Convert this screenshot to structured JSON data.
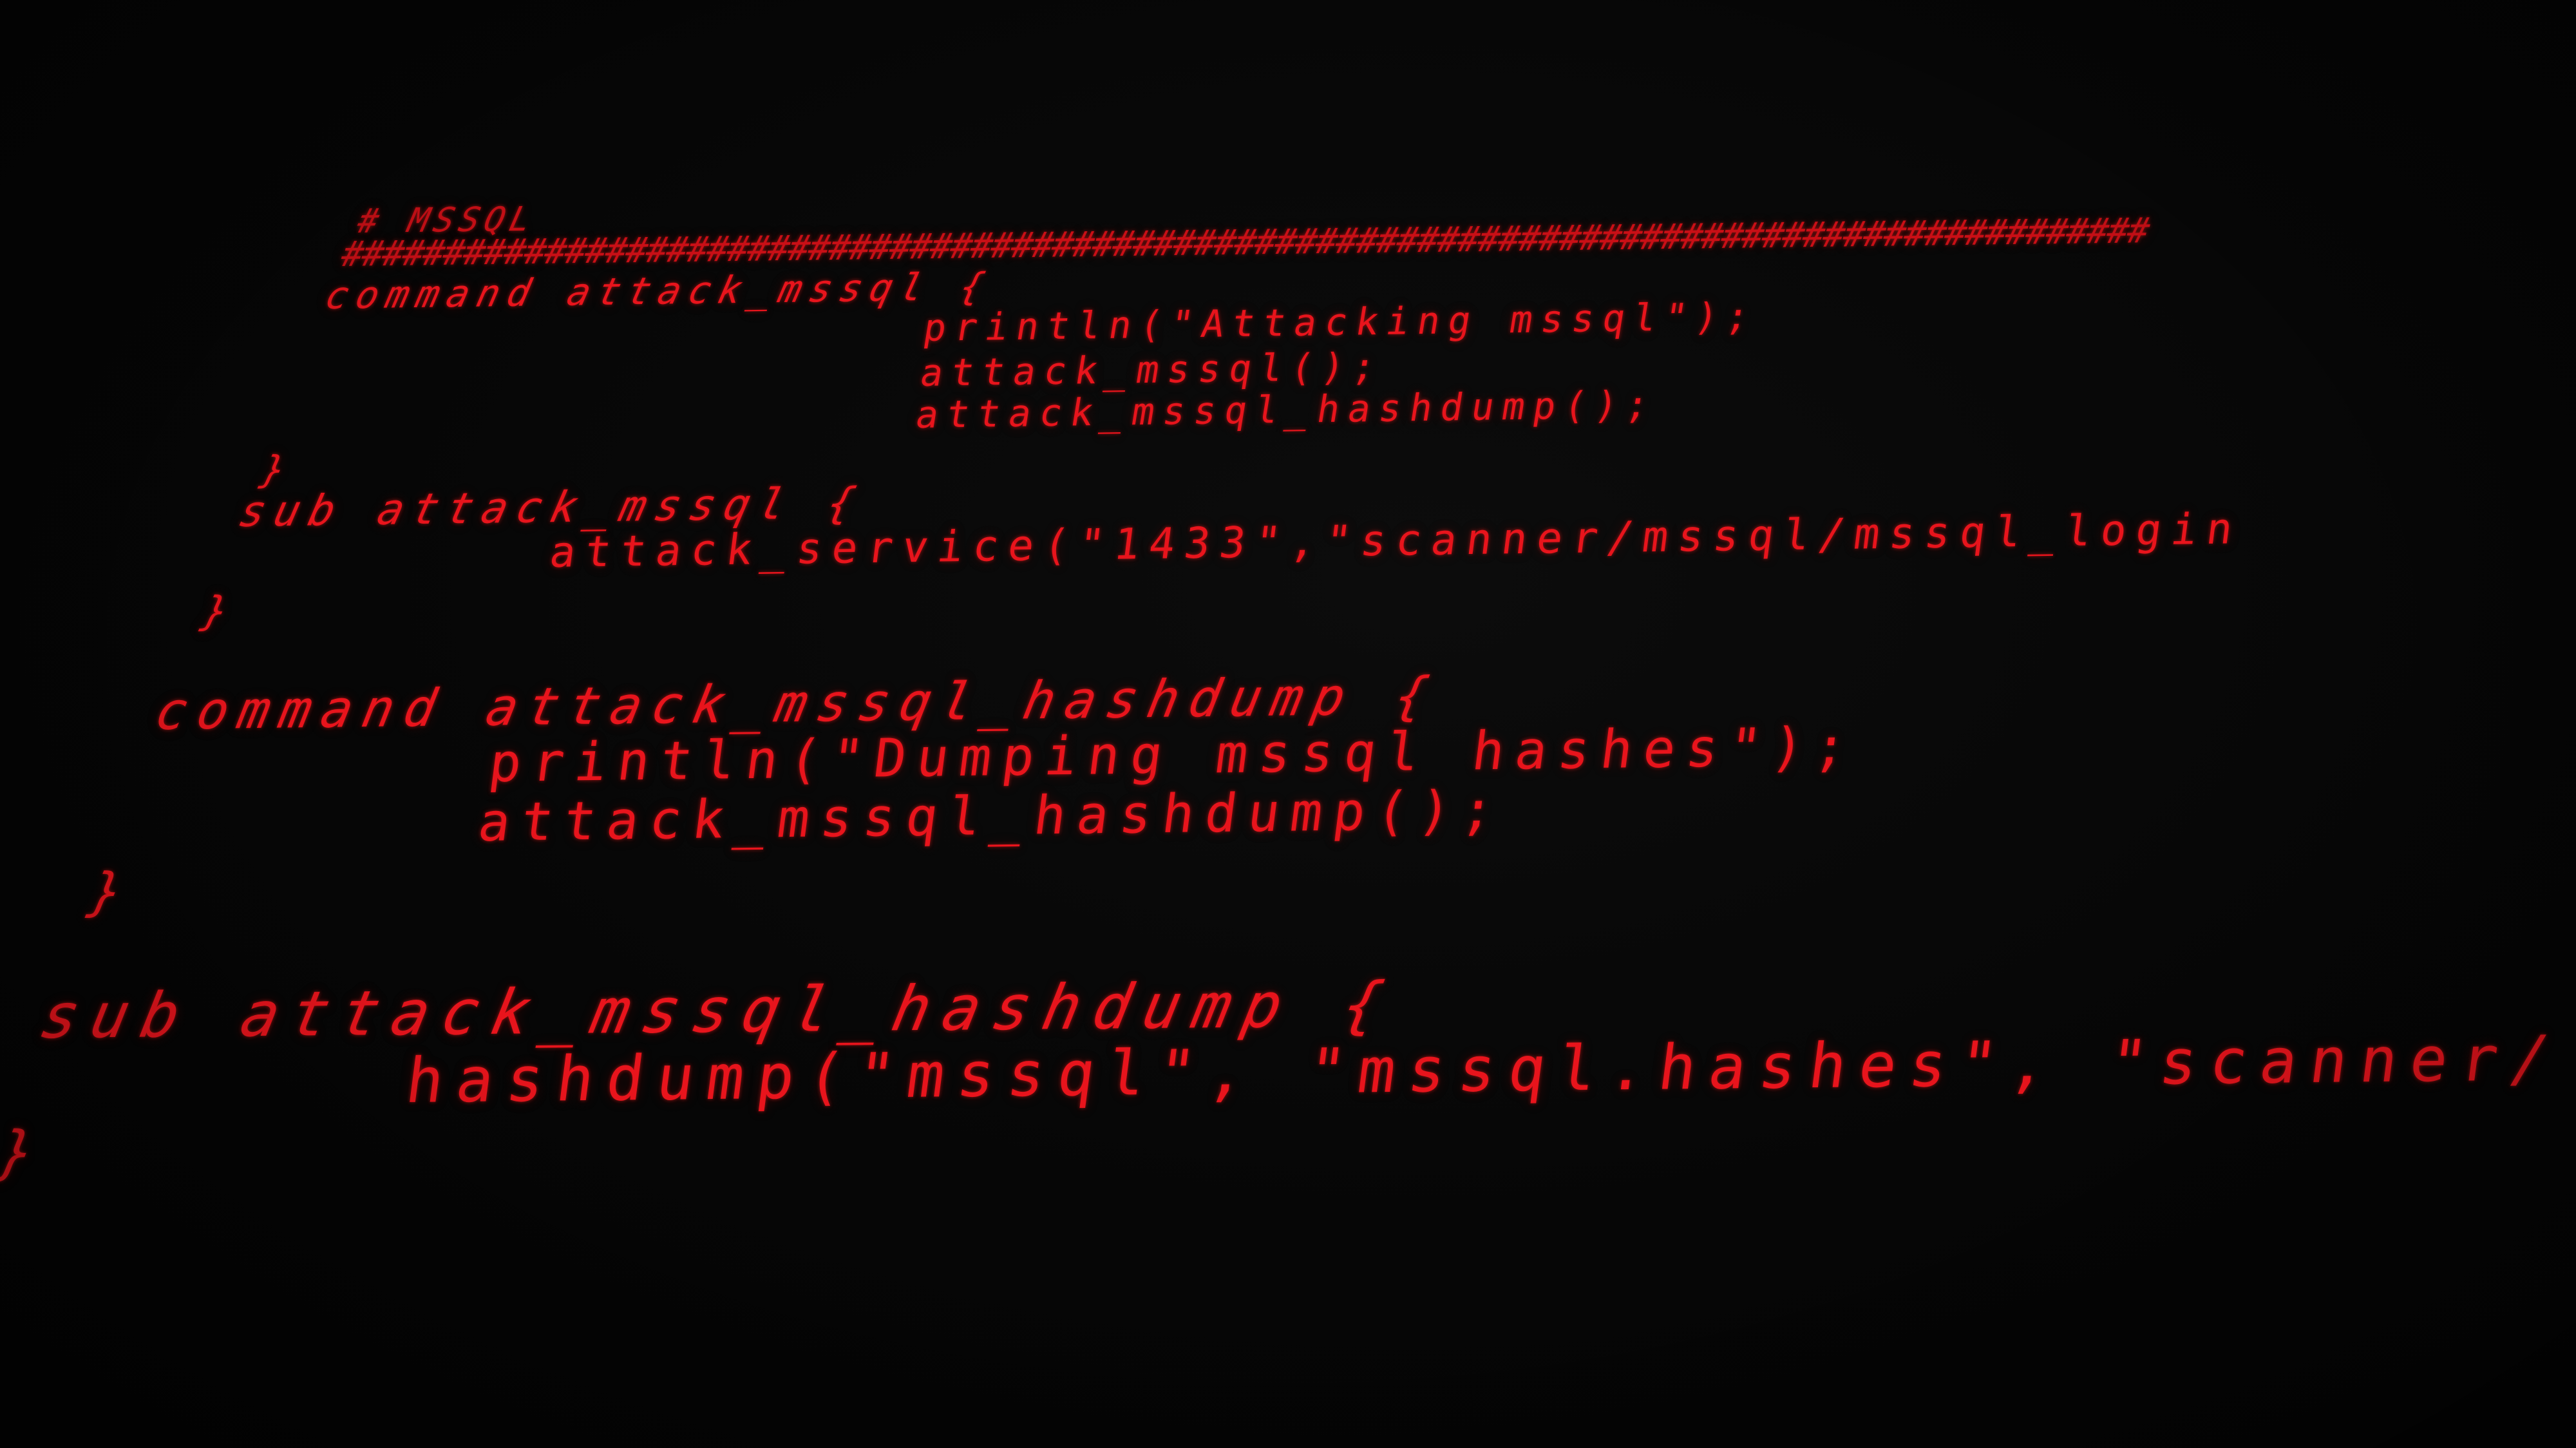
{
  "terminal": {
    "lines": {
      "comment": "# MSSQL",
      "hashes": "#########################################################################################",
      "cmd1_open": "command attack_mssql {",
      "cmd1_println": "println(\"Attacking mssql\");",
      "cmd1_call1": "attack_mssql();",
      "cmd1_call2": "attack_mssql_hashdump();",
      "cmd1_close": "}",
      "sub1_open": "sub attack_mssql {",
      "sub1_body": "attack_service(\"1433\",\"scanner/mssql/mssql_login",
      "sub1_close": "}",
      "cmd2_open": "command attack_mssql_hashdump {",
      "cmd2_println": "println(\"Dumping mssql hashes\");",
      "cmd2_call": "attack_mssql_hashdump();",
      "cmd2_close": "}",
      "sub2_open": "sub attack_mssql_hashdump {",
      "sub2_body": "hashdump(\"mssql\", \"mssql.hashes\", \"scanner/",
      "sub2_close": "}"
    },
    "text_color": "#e8141c",
    "background_color": "#050505"
  }
}
